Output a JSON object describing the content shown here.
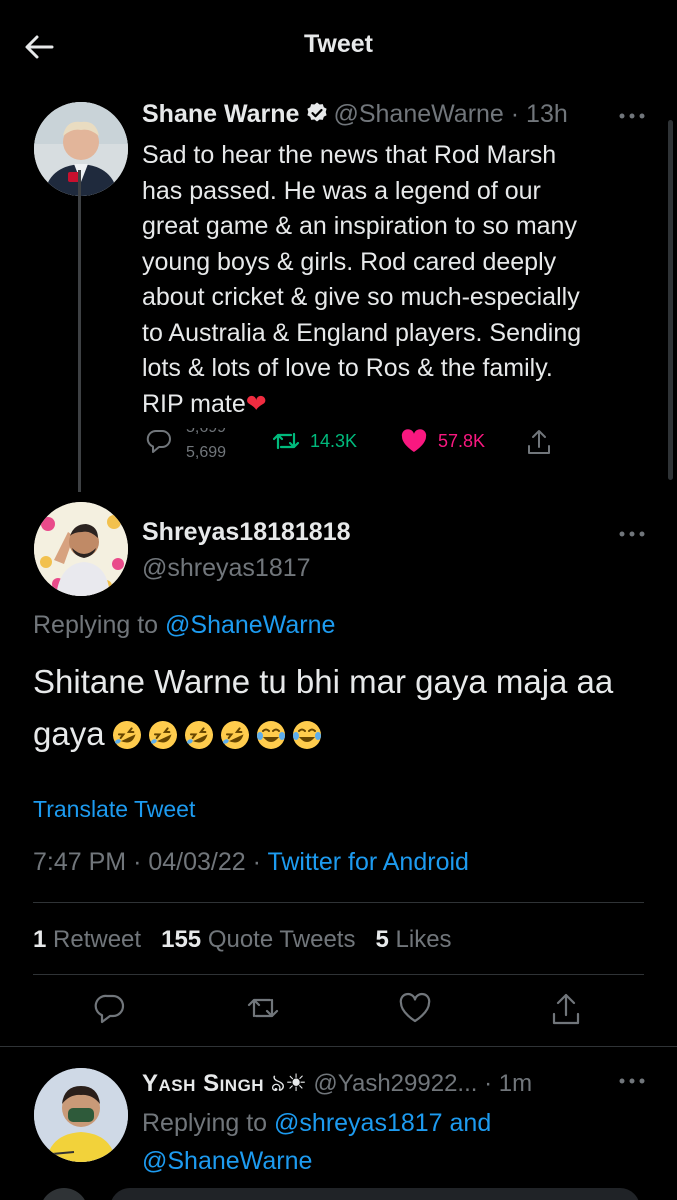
{
  "header": {
    "title": "Tweet"
  },
  "parent_tweet": {
    "display_name": "Shane Warne",
    "handle": "@ShaneWarne",
    "time": "· 13h",
    "text": "Sad to hear the news that Rod Marsh\nhas passed. He was a legend of our\ngreat game & an inspiration to so many\nyoung boys &  girls. Rod cared deeply\nabout cricket & give so much-especially\nto Australia & England players. Sending\nlots & lots of love to Ros & the family.\nRIP mate",
    "text_emoji": "❤",
    "reply_count_top": "5,699",
    "reply_count_bottom": "5,699",
    "retweets": "14.3K",
    "likes": "57.8K"
  },
  "main_tweet": {
    "display_name": "Shreyas18181818",
    "handle": "@shreyas1817",
    "replying_prefix": "Replying to",
    "replying_to": "@ShaneWarne",
    "text": "Shitane Warne tu bhi mar gaya maja aa gaya",
    "translate_label": "Translate Tweet",
    "time": "7:47 PM",
    "date": "04/03/22",
    "separator": "·",
    "client": "Twitter for Android",
    "retweet_count": "1",
    "retweet_label": "Retweet",
    "quote_count": "155",
    "quote_label": "Quote Tweets",
    "like_count": "5",
    "like_label": "Likes"
  },
  "reply_tweet": {
    "display_name": "Yash Singh",
    "name_suffix": "ঌ☀",
    "handle": "@Yash29922...",
    "time": "· 1m",
    "replying_prefix": "Replying to",
    "replying_to_1": "@shreyas1817",
    "replying_and": "and",
    "replying_to_2": "@ShaneWarne"
  },
  "colors": {
    "accent": "#1d9bf0",
    "like": "#f91880",
    "retweet": "#00ba7c",
    "text": "#e7e9ea",
    "muted": "#71767b"
  },
  "icons": [
    "back-arrow-icon",
    "verified-badge-icon",
    "more-icon",
    "reply-icon",
    "retweet-icon",
    "like-icon",
    "share-icon",
    "rolling-laughing-emoji",
    "tears-of-joy-emoji"
  ]
}
